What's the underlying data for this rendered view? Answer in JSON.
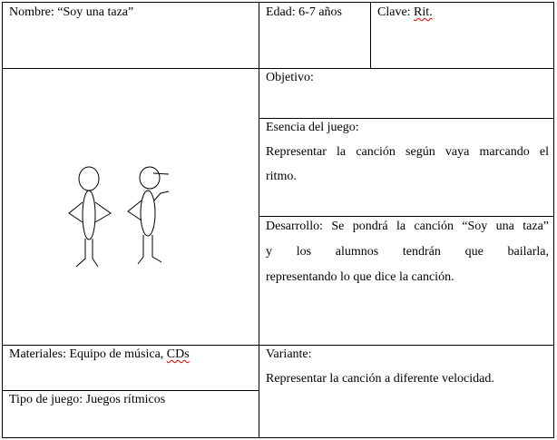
{
  "card": {
    "nombre": {
      "label": "Nombre:",
      "value": "“Soy una taza”"
    },
    "edad": {
      "label": "Edad:",
      "value": "6-7 años"
    },
    "clave": {
      "label": "Clave:",
      "value": "Rit."
    },
    "objetivo": {
      "label": "Objetivo:"
    },
    "esencia": {
      "label": "Esencia del juego:",
      "line1": "Representar la canción según vaya marcando el",
      "line2": "ritmo."
    },
    "desarrollo": {
      "line1": "Desarrollo: Se pondrá la canción “Soy una taza”",
      "line2": "y los alumnos tendrán que bailarla,",
      "line3": "representando lo que dice la canción."
    },
    "materiales": {
      "label": "Materiales: Equipo de música,",
      "value": "CDs"
    },
    "tipo": {
      "label": "Tipo de juego: Juegos rítmicos"
    },
    "variante": {
      "label": "Variante:",
      "value": "Representar la canción a diferente velocidad."
    }
  }
}
